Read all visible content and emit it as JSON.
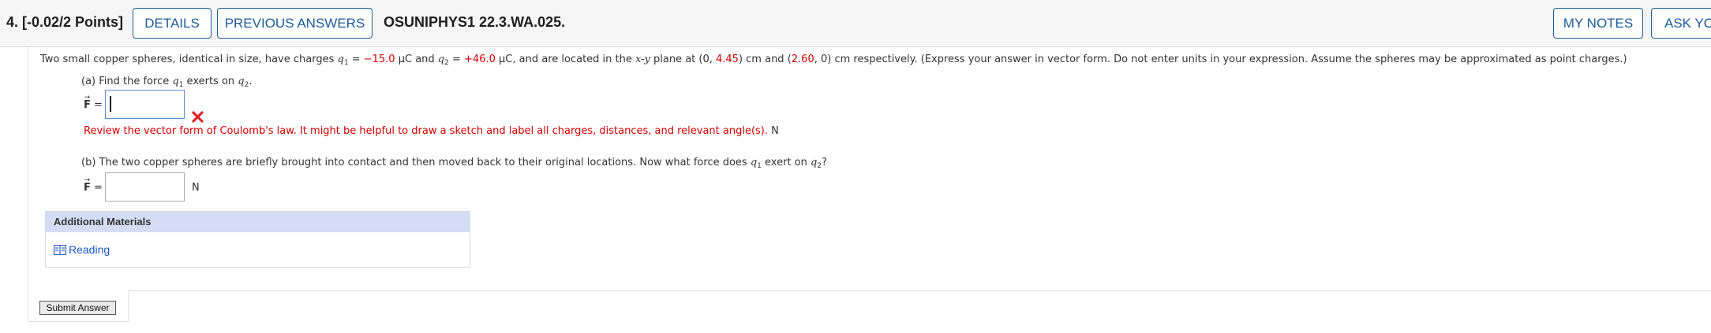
{
  "header": {
    "question_number": "4. [-0.02/2 Points]",
    "details_label": "DETAILS",
    "previous_answers_label": "PREVIOUS ANSWERS",
    "question_code": "OSUNIPHYS1 22.3.WA.025.",
    "my_notes_label": "MY NOTES",
    "ask_label": "ASK YOUR TEACHER"
  },
  "problem": {
    "intro_start": "Two small copper spheres, identical in size, have charges",
    "q1_var": "q",
    "q1_sub": "1",
    "q1_eq": " = ",
    "q1_value": "−15.0",
    "q1_unit": " μC",
    "and1": " and ",
    "q2_var": "q",
    "q2_sub": "2",
    "q2_eq": " = ",
    "q2_value": "+46.0",
    "q2_unit": " μC,",
    "located_text": "and are located in the",
    "plane_var": "x-y",
    "plane_at": " plane at (0, ",
    "pos1_y": "4.45",
    "pos1_end": ") cm and (",
    "pos2_x": "2.60",
    "pos2_end": ", 0) cm respectively. (Express your answer in vector form. Do not enter units in your expression. Assume the spheres may be approximated as point charges.)"
  },
  "part_a": {
    "prompt_start": "(a) Find the force",
    "q1": "q",
    "q1_sub": "1",
    "mid": " exerts on",
    "q2": "q",
    "q2_sub": "2",
    "end": ".",
    "vector_label": "F",
    "equals": " =",
    "input_value": "",
    "feedback": "Review the vector form of Coulomb's law. It might be helpful to draw a sketch and label all charges, distances, and relevant angle(s).",
    "unit": "N"
  },
  "part_b": {
    "prompt_start": "(b) The two copper spheres are briefly brought into contact and then moved back to their original locations. Now what force does",
    "q1": "q",
    "q1_sub": "1",
    "mid": " exert on",
    "q2": "q",
    "q2_sub": "2",
    "end": "?",
    "vector_label": "F",
    "equals": " =",
    "input_value": "",
    "unit": "N"
  },
  "additional_materials": {
    "title": "Additional Materials",
    "reading_label": "Reading"
  },
  "submit_label": "Submit Answer",
  "colors": {
    "accent": "#1f5c99",
    "error": "#d40000",
    "link": "#1a56c6",
    "panel_header": "#d4ddf5"
  },
  "icons": {
    "incorrect": "x-mark-icon",
    "reading": "book-icon"
  }
}
